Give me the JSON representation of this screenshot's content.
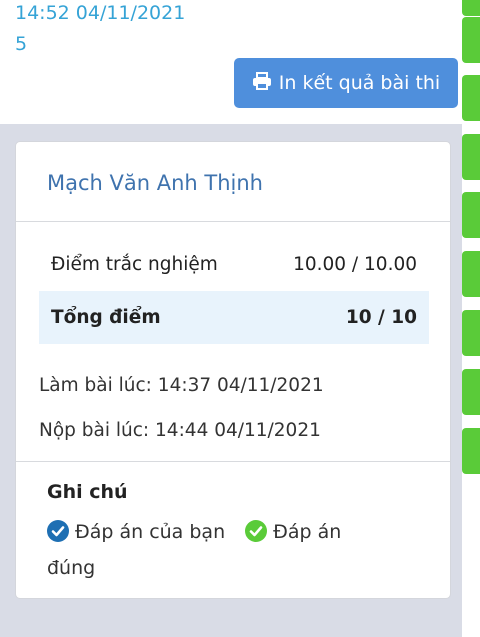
{
  "header": {
    "line1": "14:52 04/11/2021",
    "line2": "5",
    "print_button_label": "In kết quả bài thi"
  },
  "result": {
    "student_name": "Mạch Văn Anh Thịnh",
    "rows": [
      {
        "label": "Điểm trắc nghiệm",
        "value": "10.00 / 10.00"
      },
      {
        "label": "Tổng điểm",
        "value": "10 / 10"
      }
    ],
    "started": "Làm bài lúc: 14:37 04/11/2021",
    "submitted": "Nộp bài lúc: 14:44 04/11/2021"
  },
  "notes": {
    "title": "Ghi chú",
    "legend_yours": "Đáp án của bạn",
    "legend_correct": "Đáp án đúng",
    "legend_correct_part1": "Đáp án",
    "legend_correct_part2": "đúng"
  },
  "colors": {
    "accent": "#4f8fdc",
    "name": "#3f73ae",
    "time": "#35a3d6",
    "highlight_row": "#e8f3fc",
    "correct": "#5acb39",
    "your_answer": "#1e6fb3"
  }
}
